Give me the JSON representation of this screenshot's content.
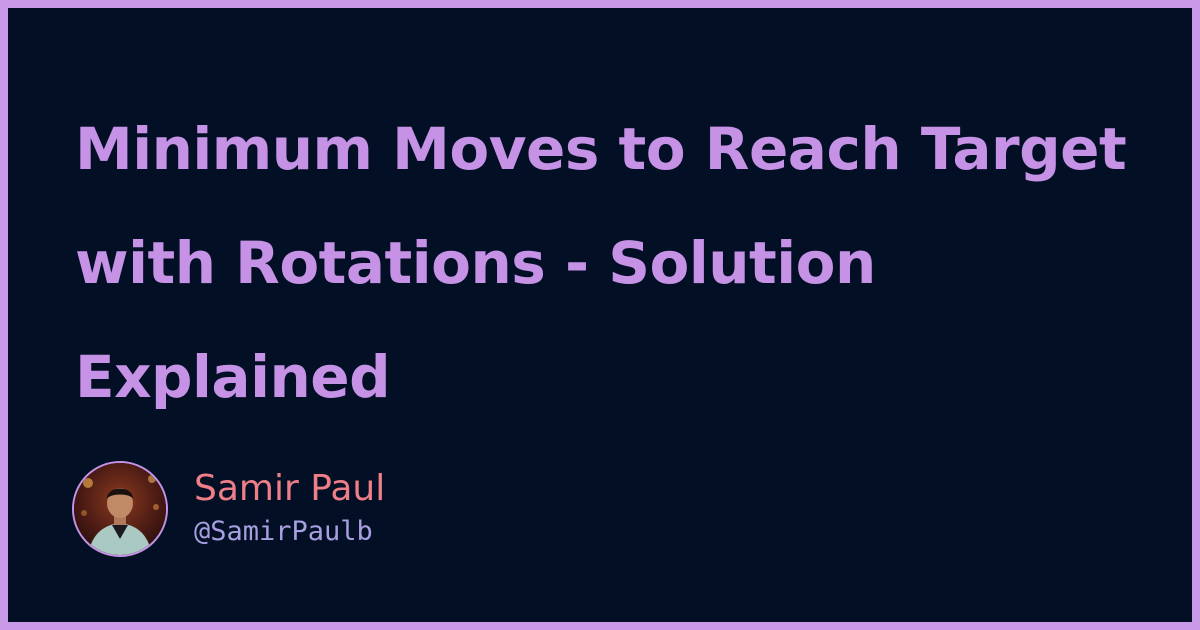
{
  "post": {
    "title": "Minimum Moves to Reach Target with Rotations - Solution Explained"
  },
  "author": {
    "name": "Samir Paul",
    "handle": "@SamirPaulb",
    "avatar_icon": "avatar-photo"
  },
  "colors": {
    "frame": "#c89ae8",
    "background": "#020f24",
    "title": "#c592e6",
    "author_name": "#ee7f89",
    "author_handle": "#a79fe0"
  }
}
